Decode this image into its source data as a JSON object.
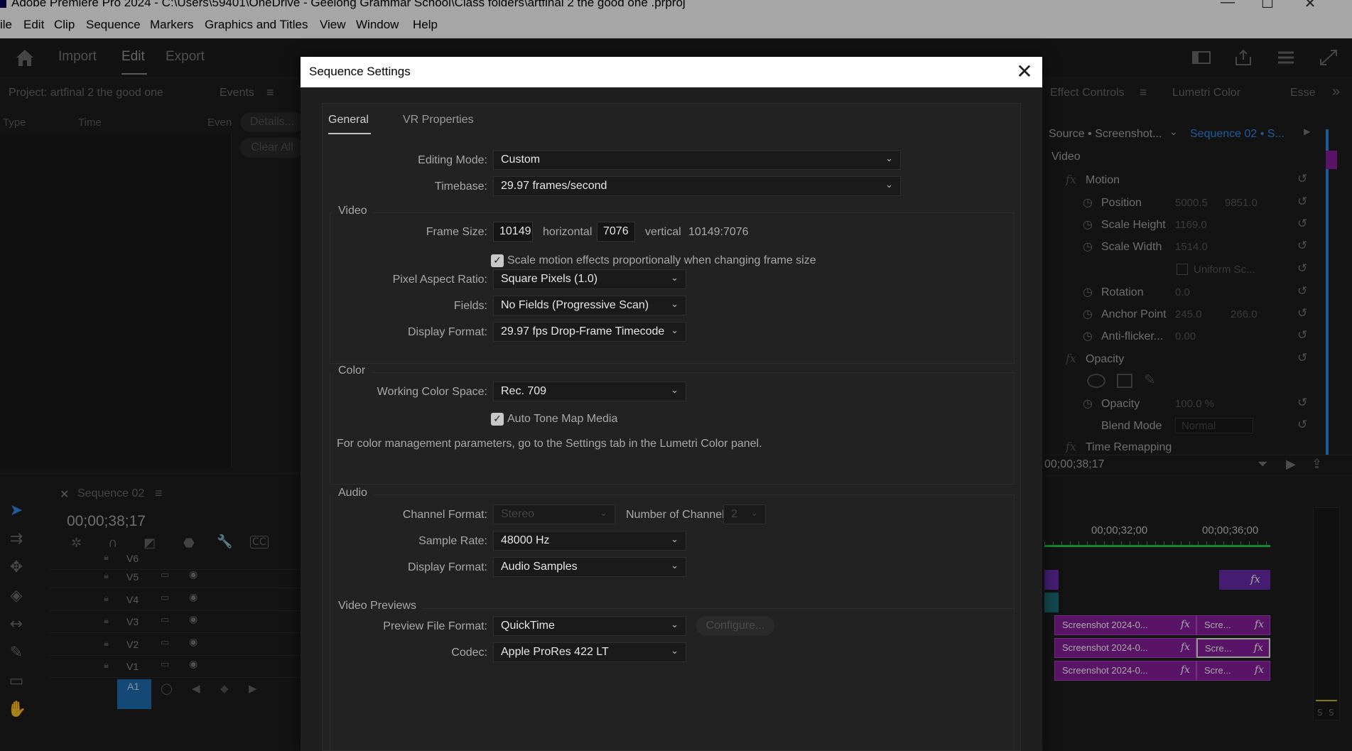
{
  "window": {
    "title": "Adobe Premiere Pro 2024 - C:\\Users\\59401\\OneDrive - Geelong Grammar School\\Class folders\\artfinal 2 the good one .prproj",
    "minimize": "—",
    "maximize": "☐",
    "close": "✕"
  },
  "menu": [
    "ile",
    "Edit",
    "Clip",
    "Sequence",
    "Markers",
    "Graphics and Titles",
    "View",
    "Window",
    "Help"
  ],
  "header": {
    "workspaces": [
      "Import",
      "Edit",
      "Export"
    ],
    "active_workspace": "Edit"
  },
  "project_panel": {
    "tab": "Project: artfinal 2 the good one",
    "events_tab": "Events",
    "columns": [
      "Type",
      "Time",
      "Even"
    ],
    "details_button": "Details...",
    "clear_button": "Clear All"
  },
  "timeline": {
    "tab": "Sequence 02",
    "timecode": "00;00;38;17",
    "tracks": [
      "V6",
      "V5",
      "V4",
      "V3",
      "V2",
      "V1"
    ],
    "audio_track": "A1"
  },
  "effect_controls": {
    "tabs": [
      "Effect Controls",
      "Lumetri Color",
      "Esse"
    ],
    "source": "Source • Screenshot...",
    "sequence": "Sequence 02 • S...",
    "section": "Video",
    "rows": [
      {
        "name": "Motion",
        "values": []
      },
      {
        "name": "Position",
        "values": [
          "5000.5",
          "9851.0"
        ]
      },
      {
        "name": "Scale Height",
        "values": [
          "1169.0"
        ]
      },
      {
        "name": "Scale Width",
        "values": [
          "1514.0"
        ]
      },
      {
        "name": "Uniform Sc...",
        "values": []
      },
      {
        "name": "Rotation",
        "values": [
          "0.0"
        ]
      },
      {
        "name": "Anchor Point",
        "values": [
          "245.0",
          "266.0"
        ]
      },
      {
        "name": "Anti-flicker...",
        "values": [
          "0.00"
        ]
      },
      {
        "name": "Opacity",
        "values": []
      },
      {
        "name": "Opacity",
        "values": [
          "100.0 %"
        ]
      },
      {
        "name": "Blend Mode",
        "values": [
          "Normal"
        ]
      },
      {
        "name": "Time Remapping",
        "values": []
      }
    ],
    "timecode": "00;00;38;17"
  },
  "program_timeline": {
    "ruler": [
      "00;00;32;00",
      "00;00;36;00"
    ],
    "clips": [
      {
        "label": "Screenshot 2024-0...",
        "short": "Scre..."
      },
      {
        "label": "Screenshot 2024-0...",
        "short": "Scre..."
      },
      {
        "label": "Screenshot 2024-0...",
        "short": "Scre..."
      }
    ],
    "meter_labels": [
      "S",
      "S"
    ]
  },
  "dialog": {
    "title": "Sequence Settings",
    "close_glyph": "✕",
    "tabs": [
      "General",
      "VR Properties"
    ],
    "editing_mode": {
      "label": "Editing Mode:",
      "value": "Custom"
    },
    "timebase": {
      "label": "Timebase:",
      "value": "29.97  frames/second"
    },
    "video": {
      "title": "Video",
      "frame_size_label": "Frame Size:",
      "frame_width": "10149",
      "horizontal": "horizontal",
      "frame_height": "7076",
      "vertical": "vertical",
      "ratio": "10149:7076",
      "scale_checkbox": "Scale motion effects proportionally when changing frame size",
      "pixel_aspect_label": "Pixel Aspect Ratio:",
      "pixel_aspect": "Square Pixels (1.0)",
      "fields_label": "Fields:",
      "fields": "No Fields (Progressive Scan)",
      "display_format_label": "Display Format:",
      "display_format": "29.97 fps Drop-Frame Timecode"
    },
    "color": {
      "title": "Color",
      "working_space_label": "Working Color Space:",
      "working_space": "Rec. 709",
      "tone_map": "Auto Tone Map Media",
      "note": "For color management parameters, go to the Settings tab in the Lumetri Color panel."
    },
    "audio": {
      "title": "Audio",
      "channel_format_label": "Channel Format:",
      "channel_format": "Stereo",
      "channels_label": "Number of Channels:",
      "channels": "2",
      "sample_rate_label": "Sample Rate:",
      "sample_rate": "48000 Hz",
      "display_format_label": "Display Format:",
      "display_format": "Audio Samples"
    },
    "previews": {
      "title": "Video Previews",
      "file_format_label": "Preview File Format:",
      "file_format": "QuickTime",
      "configure": "Configure...",
      "codec_label": "Codec:",
      "codec": "Apple ProRes 422 LT"
    }
  },
  "colors": {
    "clip_purple": "#8b1f9e",
    "accent_blue": "#2d8ceb",
    "dialog_bg": "#1f1f1f"
  }
}
